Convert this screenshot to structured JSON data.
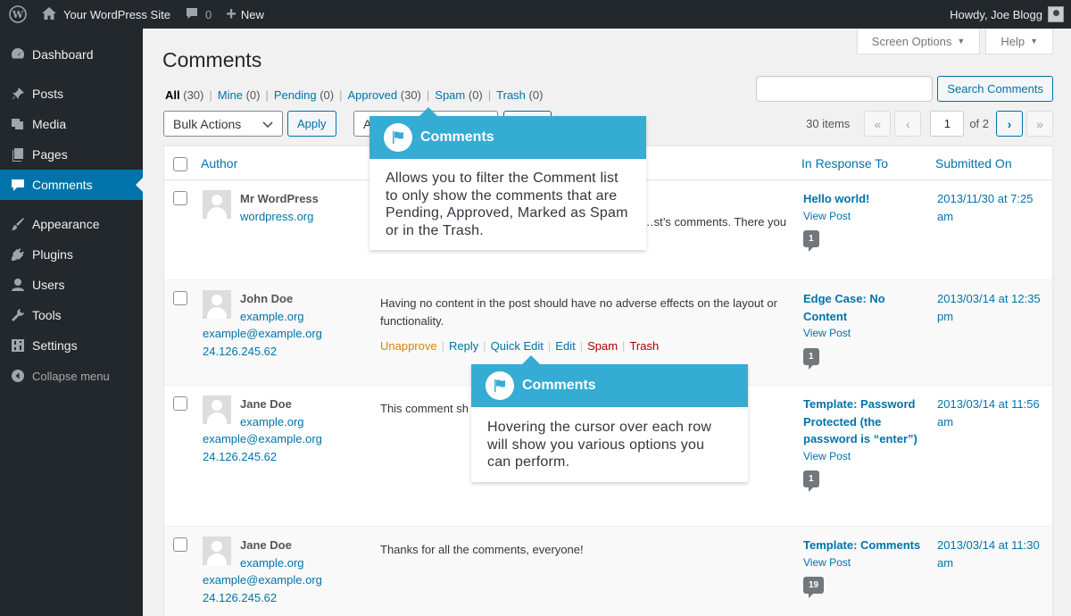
{
  "admin_bar": {
    "site_name": "Your WordPress Site",
    "comments_count": "0",
    "new_label": "New",
    "greeting": "Howdy, Joe Blogg"
  },
  "sidebar": {
    "items": [
      {
        "label": "Dashboard",
        "icon": "dashboard-icon"
      },
      {
        "label": "Posts",
        "icon": "pin-icon"
      },
      {
        "label": "Media",
        "icon": "media-icon"
      },
      {
        "label": "Pages",
        "icon": "pages-icon"
      },
      {
        "label": "Comments",
        "icon": "comment-icon",
        "active": true
      },
      {
        "label": "Appearance",
        "icon": "brush-icon"
      },
      {
        "label": "Plugins",
        "icon": "plug-icon"
      },
      {
        "label": "Users",
        "icon": "user-icon"
      },
      {
        "label": "Tools",
        "icon": "wrench-icon"
      },
      {
        "label": "Settings",
        "icon": "settings-icon"
      }
    ],
    "collapse_label": "Collapse menu"
  },
  "screen_options_label": "Screen Options",
  "help_label": "Help",
  "page_title": "Comments",
  "filters": [
    {
      "label": "All",
      "count": "(30)"
    },
    {
      "label": "Mine",
      "count": "(0)"
    },
    {
      "label": "Pending",
      "count": "(0)"
    },
    {
      "label": "Approved",
      "count": "(30)"
    },
    {
      "label": "Spam",
      "count": "(0)"
    },
    {
      "label": "Trash",
      "count": "(0)"
    }
  ],
  "search": {
    "button_label": "Search Comments",
    "value": ""
  },
  "bulk_actions": {
    "selected": "Bulk Actions",
    "apply_label": "Apply"
  },
  "filter_select_partial": "A",
  "pagination": {
    "items_label": "30 items",
    "first": "«",
    "prev": "‹",
    "current_page": "1",
    "of_label": "of 2",
    "next": "›",
    "last": "»"
  },
  "table": {
    "headers": {
      "author": "Author",
      "in_response_to": "In Response To",
      "submitted_on": "Submitted On"
    },
    "rows": [
      {
        "author_name": "Mr WordPress",
        "author_url": "wordpress.org",
        "email": "",
        "ip": "",
        "comment": "…st’s comments. There you",
        "actions": [],
        "post_title": "Hello world!",
        "view_post": "View Post",
        "bubble_count": "1",
        "submitted": "2013/11/30 at 7:25 am"
      },
      {
        "author_name": "John Doe",
        "author_url": "example.org",
        "email": "example@example.org",
        "ip": "24.126.245.62",
        "comment": "Having no content in the post should have no adverse effects on the layout or functionality.",
        "actions": [
          "Unapprove",
          "Reply",
          "Quick Edit",
          "Edit",
          "Spam",
          "Trash"
        ],
        "post_title": "Edge Case: No Content",
        "view_post": "View Post",
        "bubble_count": "1",
        "submitted": "2013/03/14 at 12:35 pm"
      },
      {
        "author_name": "Jane Doe",
        "author_url": "example.org",
        "email": "example@example.org",
        "ip": "24.126.245.62",
        "comment": "This comment sh",
        "actions": [],
        "post_title": "Template: Password Protected (the password is “enter”)",
        "view_post": "View Post",
        "bubble_count": "1",
        "submitted": "2013/03/14 at 11:56 am"
      },
      {
        "author_name": "Jane Doe",
        "author_url": "example.org",
        "email": "example@example.org",
        "ip": "24.126.245.62",
        "comment": "Thanks for all the comments, everyone!",
        "actions": [],
        "post_title": "Template: Comments",
        "view_post": "View Post",
        "bubble_count": "19",
        "submitted": "2013/03/14 at 11:30 am"
      }
    ]
  },
  "tooltips": [
    {
      "title": "Comments",
      "body": "Allows you to filter the Comment list to only show the comments that are Pending, Approved, Marked as Spam or in the Trash."
    },
    {
      "title": "Comments",
      "body": "Hovering the cursor over each row will show you various options you can perform."
    }
  ],
  "colors": {
    "accent": "#0073aa",
    "tooltip": "#35acd3",
    "adminbar": "#23282d",
    "unapprove": "#d98500",
    "danger": "#a00000"
  }
}
